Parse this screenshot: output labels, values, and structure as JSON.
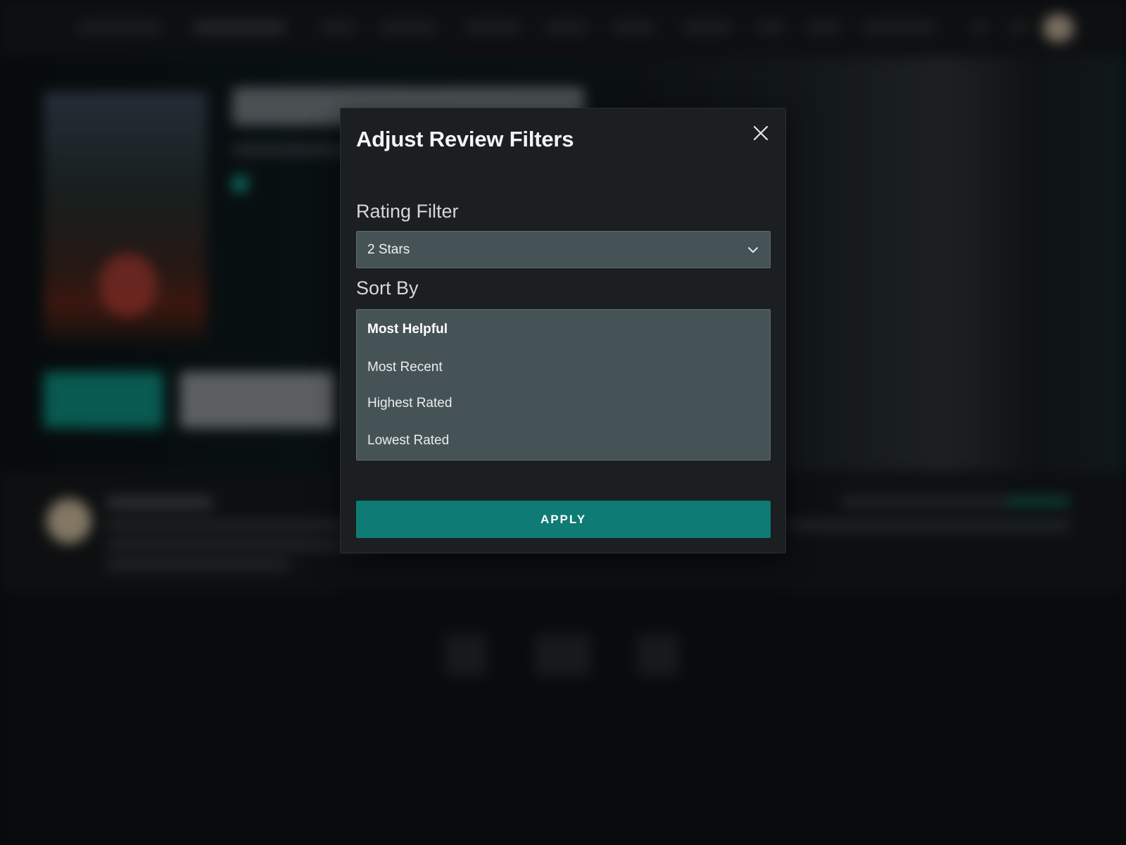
{
  "modal": {
    "title": "Adjust Review Filters",
    "close_icon": "close-icon",
    "rating_filter": {
      "label": "Rating Filter",
      "selected": "2 Stars",
      "chevron_icon": "chevron-down-icon"
    },
    "sort_by": {
      "label": "Sort By",
      "options": [
        "Most Helpful",
        "Most Recent",
        "Highest Rated",
        "Lowest Rated"
      ],
      "selected": "Most Helpful"
    },
    "apply_label": "APPLY"
  },
  "colors": {
    "modal_bg": "#1b1f22",
    "field_bg": "#465356",
    "accent": "#0f7b75",
    "page_bg": "#0e1012"
  }
}
